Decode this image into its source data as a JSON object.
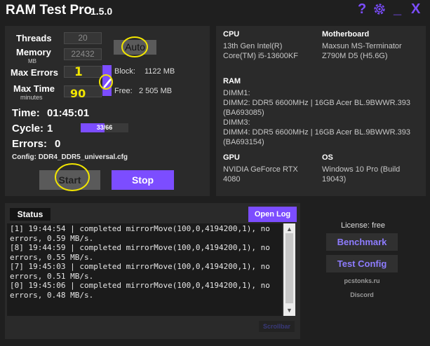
{
  "app": {
    "title": "RAM Test Pro",
    "version": "1.5.0"
  },
  "titlebar": {
    "help_icon": "question-icon",
    "settings_icon": "gear-icon",
    "minimize": "_",
    "close": "X",
    "help": "?"
  },
  "settings": {
    "threads_label": "Threads",
    "threads_value": "20",
    "memory_label": "Memory",
    "memory_unit": "MB",
    "memory_value": "22432",
    "auto_label": "Auto",
    "max_errors_label": "Max Errors",
    "max_errors_value": "",
    "max_time_label": "Max Time",
    "max_time_unit": "minutes",
    "max_time_value": "",
    "block_label": "Block:",
    "block_value": "1122 MB",
    "free_label": "Free:",
    "free_value": "2 505 MB",
    "time_label": "Time:",
    "time_value": "01:45:01",
    "cycle_label": "Cycle:",
    "cycle_value": "1",
    "cycle_progress": "33/66",
    "cycle_fraction": 0.5,
    "errors_label": "Errors:",
    "errors_value": "0",
    "config_text": "Config: DDR4_DDR5_universal.cfg",
    "start_label": "Start",
    "stop_label": "Stop"
  },
  "system": {
    "cpu_h": "CPU",
    "cpu_l1": "13th Gen Intel(R)",
    "cpu_l2": "Core(TM) i5-13600KF",
    "mb_h": "Motherboard",
    "mb_l1": "Maxsun MS-Terminator",
    "mb_l2": "Z790M D5 (H5.6G)",
    "ram_h": "RAM",
    "ram_lines": [
      "DIMM1:",
      "DIMM2: DDR5 6600MHz | 16GB Acer BL.9BWWR.393",
      "(BA693085)",
      "DIMM3:",
      "DIMM4: DDR5 6600MHz | 16GB Acer BL.9BWWR.393",
      "(BA693154)"
    ],
    "gpu_h": "GPU",
    "gpu_l1": "NVIDIA GeForce RTX",
    "gpu_l2": "4080",
    "os_h": "OS",
    "os_l1": "Windows 10 Pro (Build",
    "os_l2": "19043)"
  },
  "status": {
    "title": "Status",
    "open_log": "Open Log",
    "scrollbar_label": "Scrollbar",
    "log_text": "[1] 19:44:54 | completed mirrorMove(100,0,4194200,1), no errors, 0.59 MB/s.\n[8] 19:44:59 | completed mirrorMove(100,0,4194200,1), no errors, 0.55 MB/s.\n[7] 19:45:03 | completed mirrorMove(100,0,4194200,1), no errors, 0.51 MB/s.\n[0] 19:45:06 | completed mirrorMove(100,0,4194200,1), no errors, 0.48 MB/s."
  },
  "side": {
    "license": "License: free",
    "benchmark": "Benchmark",
    "test_config": "Test Config",
    "site": "pcstonks.ru",
    "discord": "Discord"
  },
  "annotations": {
    "one": "1",
    "ninety": "90"
  },
  "colors": {
    "accent": "#7c4dff",
    "panel": "#2a2a2a",
    "background": "#1f1f1f",
    "annotation": "#f2e600"
  }
}
